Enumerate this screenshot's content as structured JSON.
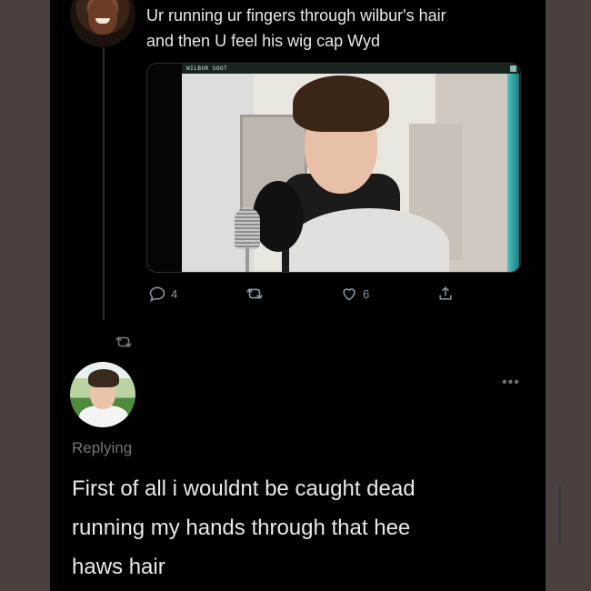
{
  "original_tweet": {
    "text_lines": [
      "Ur running ur fingers through wilbur's hair",
      "and then U feel his wig cap Wyd"
    ],
    "media": {
      "window_title": "WILBUR SOOT"
    },
    "actions": {
      "reply_icon": "reply-icon",
      "reply_count": "4",
      "retweet_icon": "retweet-icon",
      "like_icon": "heart-icon",
      "like_count": "6",
      "share_icon": "share-icon"
    }
  },
  "retweet_marker_icon": "retweet-icon",
  "reply_tweet": {
    "more_icon": "more-options-icon",
    "replying_label": "Replying",
    "text_lines": [
      "First of all i wouldnt be caught dead",
      "running my hands through that hee",
      "haws hair"
    ]
  },
  "colors": {
    "background": "#000000",
    "text_primary": "#e7e9ea",
    "text_secondary": "#8b98a5",
    "outer_frame": "#4a403d"
  }
}
